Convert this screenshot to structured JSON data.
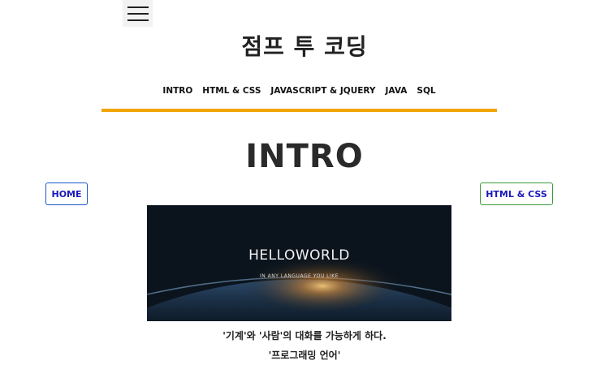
{
  "site_title": "점프 투 코딩",
  "nav": {
    "items": [
      {
        "label": "INTRO"
      },
      {
        "label": "HTML & CSS"
      },
      {
        "label": "JAVASCRIPT & JQUERY"
      },
      {
        "label": "JAVA"
      },
      {
        "label": "SQL"
      }
    ],
    "underline_color": "#f0a500"
  },
  "page_heading": "INTRO",
  "buttons": {
    "home_label": "HOME",
    "next_label": "HTML & CSS"
  },
  "hero": {
    "title": "HELLOWORLD",
    "subtitle": "IN ANY LANGUAGE YOU LIKE"
  },
  "caption": {
    "line1": "'기계'와 '사람'의 대화를 가능하게 하다.",
    "line2": "'프로그래밍 언어'"
  }
}
